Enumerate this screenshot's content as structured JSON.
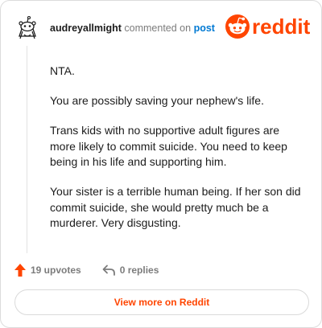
{
  "header": {
    "username": "audreyallmight",
    "commented_text": "commented on",
    "post_link": "post"
  },
  "brand": {
    "name": "reddit",
    "logo_icon": "reddit-logo-icon",
    "color": "#ff4500"
  },
  "avatar": {
    "icon": "snoo-avatar-icon"
  },
  "comment": {
    "paragraphs": [
      "NTA.",
      "You are possibly saving your nephew's life.",
      "Trans kids with no supportive adult figures are more likely to commit suicide. You need to keep being in his life and supporting him.",
      "Your sister is a terrible human being. If her son did commit suicide, she would pretty much be a murderer. Very disgusting."
    ]
  },
  "actions": {
    "upvotes_label": "19 upvotes",
    "replies_label": "0 replies",
    "upvote_icon": "upvote-arrow-icon",
    "reply_icon": "reply-arrow-icon"
  },
  "footer": {
    "view_more_label": "View more on Reddit"
  },
  "colors": {
    "accent": "#ff4500",
    "link": "#0079d3",
    "text": "#1c1c1c",
    "muted": "#7c7c7c"
  }
}
